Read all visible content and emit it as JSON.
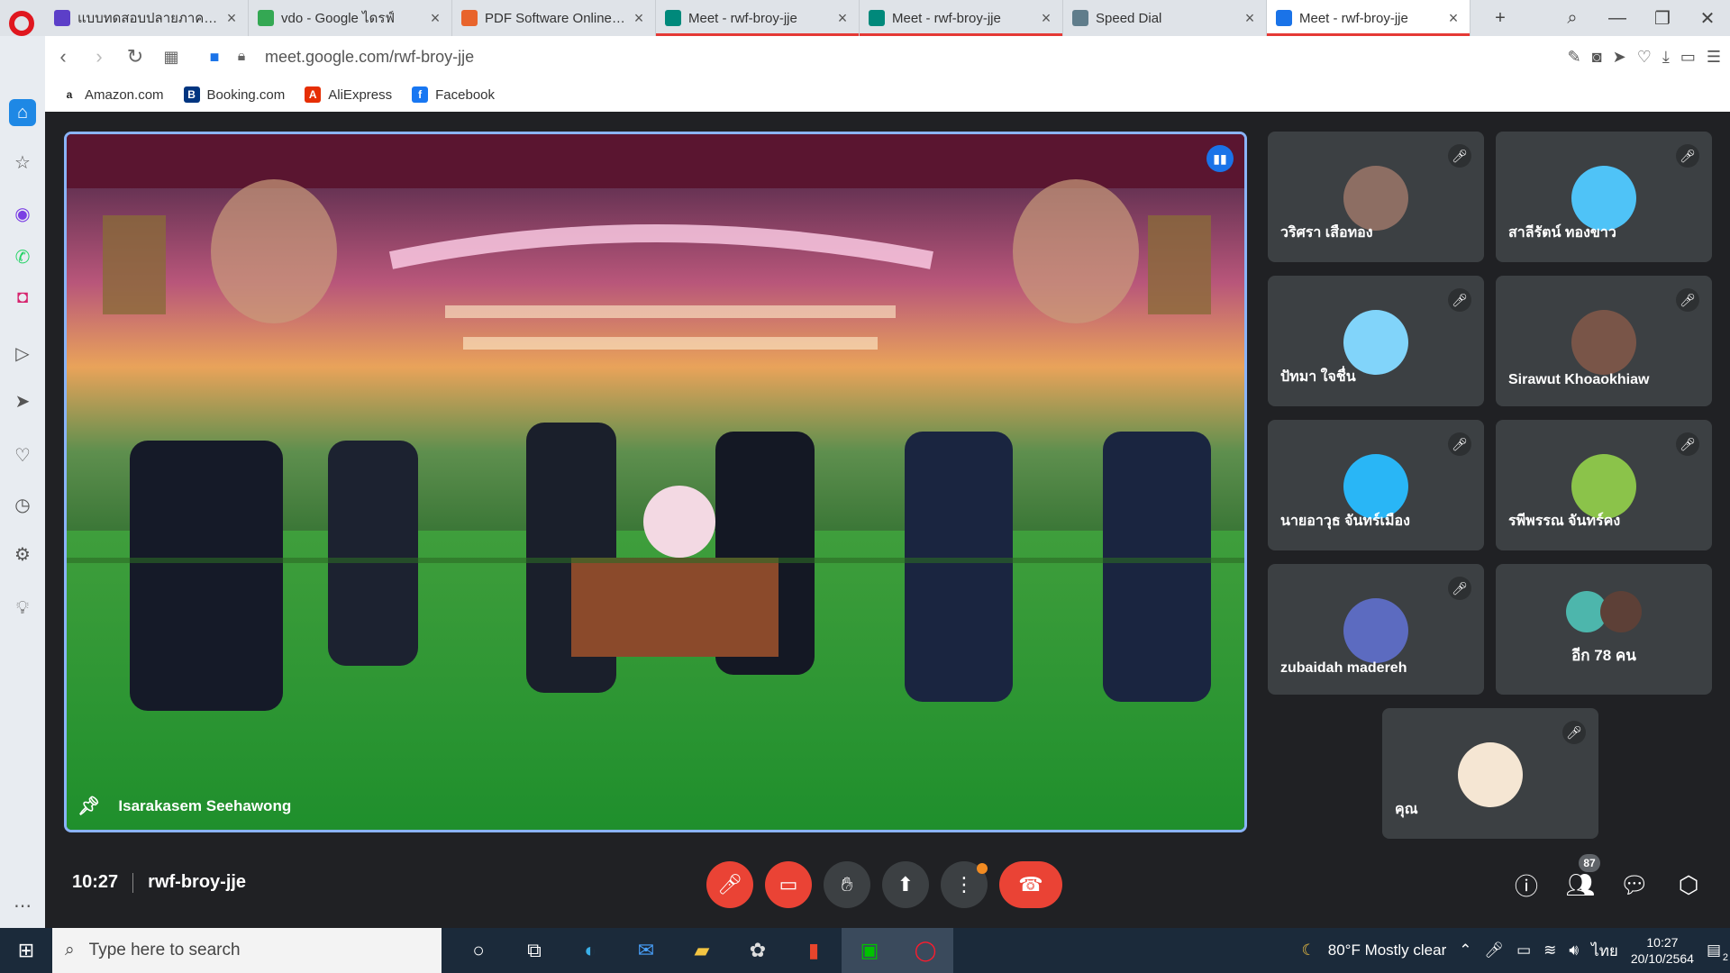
{
  "browser": {
    "tabs": [
      {
        "title": "แบบทดสอบปลายภาค วิชาวิ",
        "icon_color": "#5c3fc8"
      },
      {
        "title": "vdo - Google ไดรฟ์",
        "icon_color": "#34a853"
      },
      {
        "title": "PDF Software Online Store",
        "icon_color": "#e8642c"
      },
      {
        "title": "Meet - rwf-broy-jje",
        "icon_color": "#00897b"
      },
      {
        "title": "Meet - rwf-broy-jje",
        "icon_color": "#00897b"
      },
      {
        "title": "Speed Dial",
        "icon_color": "#607d8b"
      },
      {
        "title": "Meet - rwf-broy-jje",
        "icon_color": "#1a73e8"
      }
    ],
    "url": "meet.google.com/rwf-broy-jje",
    "bookmarks": [
      {
        "label": "Amazon.com",
        "icon": "a",
        "color": "#222"
      },
      {
        "label": "Booking.com",
        "icon": "B",
        "color": "#003580"
      },
      {
        "label": "AliExpress",
        "icon": "A",
        "color": "#e62e04"
      },
      {
        "label": "Facebook",
        "icon": "f",
        "color": "#1877f2"
      }
    ]
  },
  "meet": {
    "presenter_name": "Isarakasem Seehawong",
    "participants": [
      {
        "name": "วริศรา เสือทอง",
        "avatar_color": "#8d6e63"
      },
      {
        "name": "สาลีรัตน์ ทองขาว",
        "avatar_color": "#4fc3f7"
      },
      {
        "name": "ปัทมา ใจชื่น",
        "avatar_color": "#81d4fa"
      },
      {
        "name": "Sirawut Khoaokhiaw",
        "avatar_color": "#795548"
      },
      {
        "name": "นายอาวุธ จันทร์เมือง",
        "avatar_color": "#29b6f6"
      },
      {
        "name": "รพีพรรณ จันทร์คง",
        "avatar_color": "#8bc34a"
      },
      {
        "name": "zubaidah madereh",
        "avatar_color": "#5c6bc0"
      }
    ],
    "more_label": "อีก 78 คน",
    "self_name": "คุณ",
    "time": "10:27",
    "meeting_code": "rwf-broy-jje",
    "people_count": "87"
  },
  "taskbar": {
    "search_placeholder": "Type here to search",
    "weather": "80°F  Mostly clear",
    "lang": "ไทย",
    "time": "10:27",
    "date": "20/10/2564",
    "notifications": "2"
  }
}
